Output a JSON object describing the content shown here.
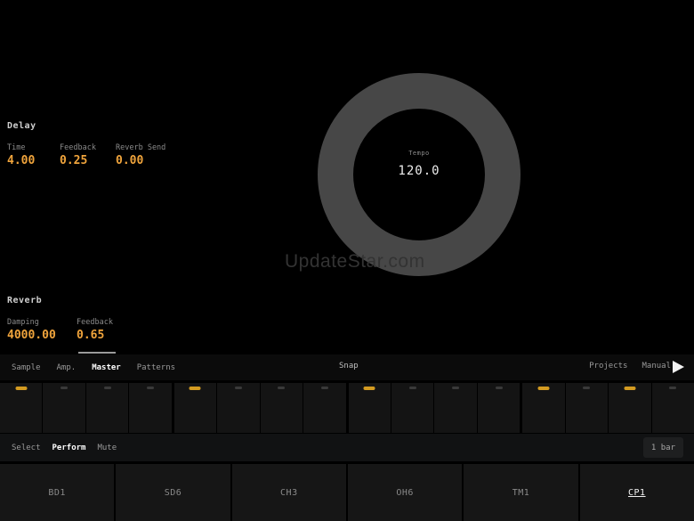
{
  "colors": {
    "background": "#000000",
    "accent_value": "#f0a43c",
    "step_active": "#d39b21",
    "knob_ring": "#474747",
    "tab_active": "#ffffff",
    "watermark": "#333333"
  },
  "effects": {
    "delay": {
      "title": "Delay",
      "params": [
        {
          "label": "Time",
          "value": "4.00"
        },
        {
          "label": "Feedback",
          "value": "0.25"
        },
        {
          "label": "Reverb Send",
          "value": "0.00"
        }
      ]
    },
    "reverb": {
      "title": "Reverb",
      "params": [
        {
          "label": "Damping",
          "value": "4000.00"
        },
        {
          "label": "Feedback",
          "value": "0.65"
        }
      ]
    }
  },
  "tempo_knob": {
    "label": "Tempo",
    "value": "120.0"
  },
  "watermark": {
    "text": "UpdateStar.com"
  },
  "tab_bar": {
    "tabs": [
      {
        "label": "Sample",
        "active": false
      },
      {
        "label": "Amp.",
        "active": false
      },
      {
        "label": "Master",
        "active": true
      },
      {
        "label": "Patterns",
        "active": false
      }
    ],
    "snap_label": "Snap",
    "right_items": [
      {
        "label": "Projects"
      },
      {
        "label": "Manual"
      }
    ],
    "play_icon": "play-triangle"
  },
  "sequencer": {
    "steps": [
      {
        "on": true
      },
      {
        "on": false
      },
      {
        "on": false
      },
      {
        "on": false
      },
      {
        "on": true
      },
      {
        "on": false
      },
      {
        "on": false
      },
      {
        "on": false
      },
      {
        "on": true
      },
      {
        "on": false
      },
      {
        "on": false
      },
      {
        "on": false
      },
      {
        "on": true
      },
      {
        "on": false
      },
      {
        "on": true
      },
      {
        "on": false
      }
    ]
  },
  "mode_bar": {
    "modes": [
      {
        "label": "Select",
        "active": false
      },
      {
        "label": "Perform",
        "active": true
      },
      {
        "label": "Mute",
        "active": false
      }
    ],
    "bar_length": "1 bar"
  },
  "pads": [
    {
      "label": "BD1",
      "selected": false
    },
    {
      "label": "SD6",
      "selected": false
    },
    {
      "label": "CH3",
      "selected": false
    },
    {
      "label": "OH6",
      "selected": false
    },
    {
      "label": "TM1",
      "selected": false
    },
    {
      "label": "CP1",
      "selected": true
    }
  ]
}
